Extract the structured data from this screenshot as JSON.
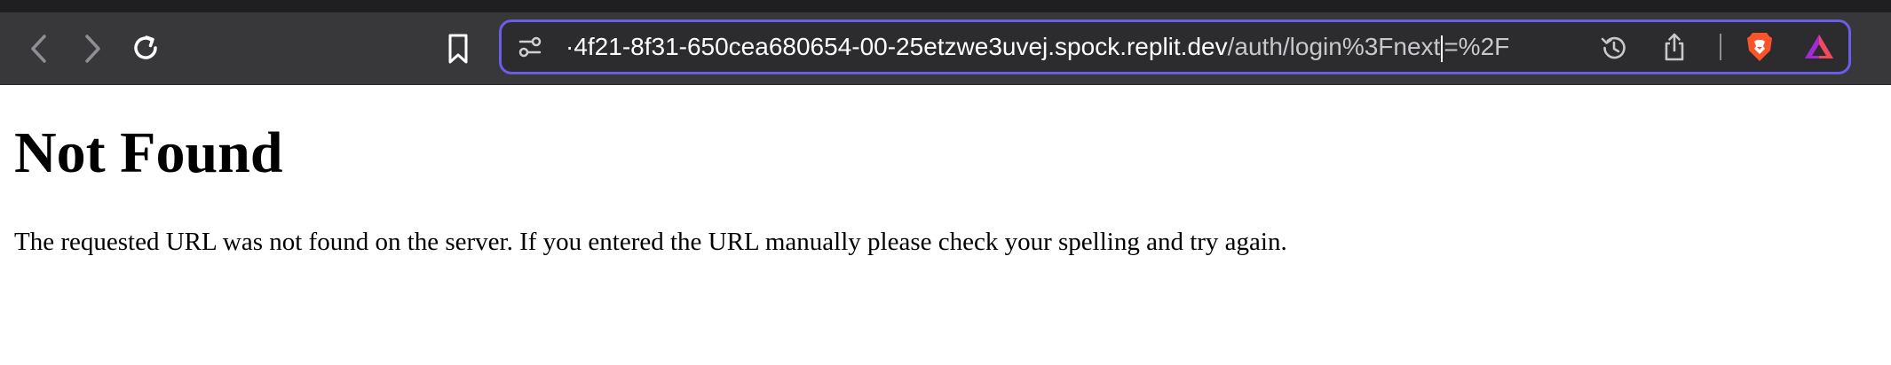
{
  "browser": {
    "url_visible_host": "·4f21-8f31-650cea680654-00-25etzwe3uvej.spock.replit.dev",
    "url_visible_path_before_caret": "/auth/login%3Fnext",
    "url_visible_path_after_caret": "=%2F",
    "icons": [
      "back-icon",
      "forward-icon",
      "reload-icon",
      "bookmark-icon",
      "site-settings-icon",
      "history-icon",
      "share-icon",
      "brave-shields-icon",
      "brave-rewards-icon"
    ],
    "colors": {
      "focus_ring": "#6c5ce7",
      "toolbar": "#38383b",
      "brave_orange": "#fb542b"
    }
  },
  "page": {
    "title": "Not Found",
    "message": "The requested URL was not found on the server. If you entered the URL manually please check your spelling and try again."
  }
}
